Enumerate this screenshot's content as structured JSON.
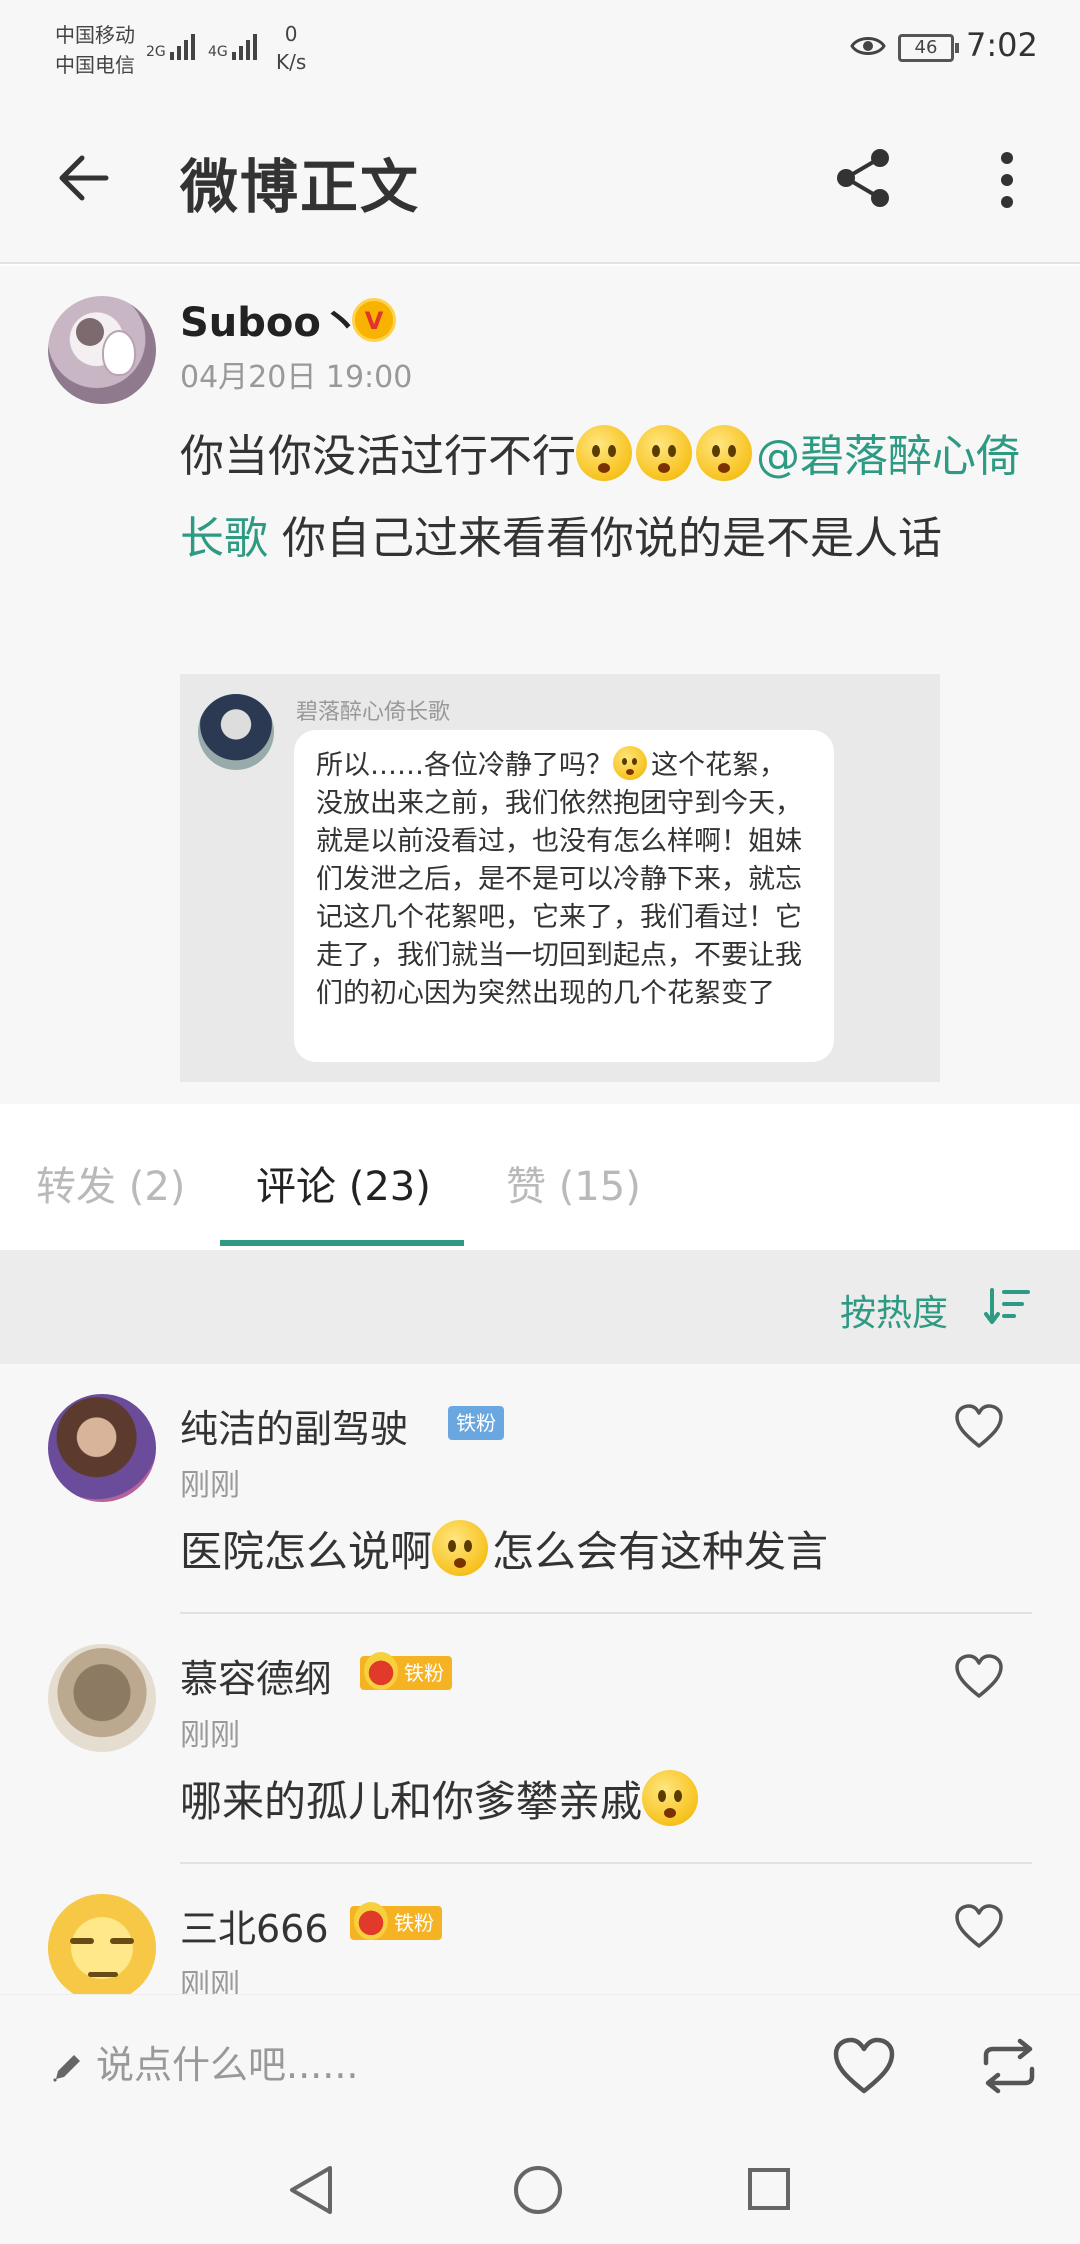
{
  "status_bar": {
    "carrier_1": "中国移动",
    "carrier_2": "中国电信",
    "net_1": "2G",
    "net_2": "4G",
    "speed_value": "0",
    "speed_unit": "K/s",
    "battery": "46",
    "time": "7:02"
  },
  "header": {
    "title": "微博正文",
    "back_icon": "arrow-left-icon",
    "share_icon": "share-icon",
    "more_icon": "more-vertical-icon"
  },
  "post": {
    "author": "Suboo丶",
    "verified_mark": "V",
    "time": "04月20日 19:00",
    "text_part1": "你当你没活过行不行",
    "mention": "@碧落醉心倚长歌",
    "text_part2": " 你自己过来看看你说的是不是人话",
    "quote": {
      "name": "碧落醉心倚长歌",
      "text_part1": "所以……各位冷静了吗？",
      "text_part2": "这个花絮，没放出来之前，我们依然抱团守到今天，就是以前没看过，也没有怎么样啊！姐妹们发泄之后，是不是可以冷静下来，就忘记这几个花絮吧，它来了，我们看过！它走了，我们就当一切回到起点，不要让我们的初心因为突然出现的几个花絮变了"
    }
  },
  "tabs": [
    {
      "label": "转发 (2)"
    },
    {
      "label": "评论 (23)"
    },
    {
      "label": "赞 (15)"
    }
  ],
  "sort": {
    "label": "按热度",
    "icon": "sort-icon"
  },
  "comments": [
    {
      "name": "纯洁的副驾驶",
      "badge": "铁粉",
      "time": "刚刚",
      "text": "医院怎么说啊",
      "text_after": "怎么会有这种发言"
    },
    {
      "name": "慕容德纲",
      "badge": "铁粉",
      "time": "刚刚",
      "text": "哪来的孤儿和你爹攀亲戚",
      "text_after": ""
    },
    {
      "name": "三北666",
      "badge": "铁粉",
      "time": "刚刚",
      "text": "",
      "text_after": ""
    }
  ],
  "input_bar": {
    "placeholder": "说点什么吧......"
  },
  "colors": {
    "accent": "#2f9a84",
    "background": "#f7f7f7"
  }
}
